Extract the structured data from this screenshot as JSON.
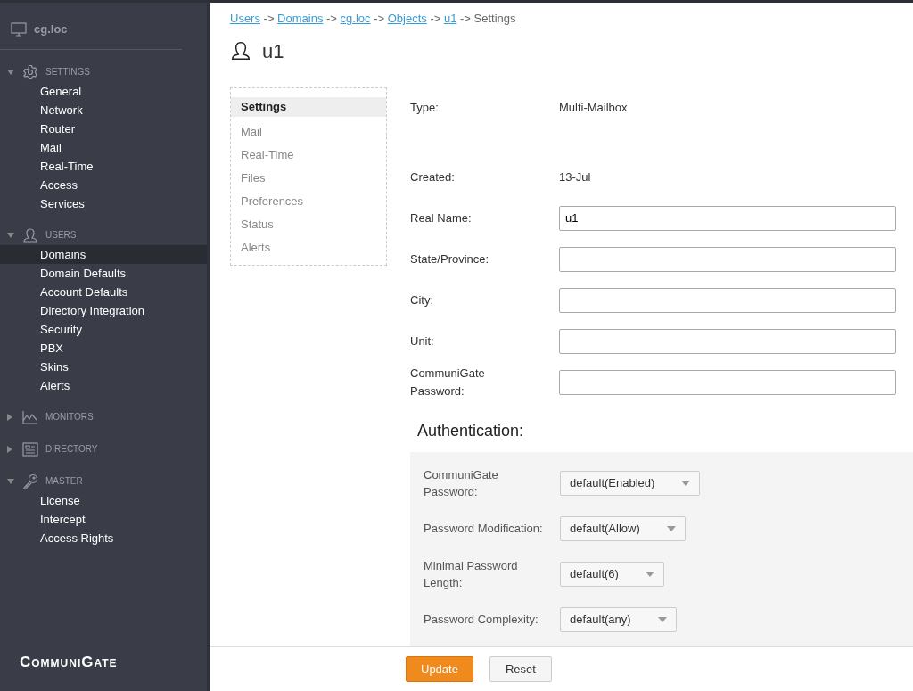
{
  "server": {
    "name": "cg.loc"
  },
  "sidebar": {
    "sections": [
      {
        "title": "SETTINGS",
        "expanded": true,
        "items": [
          {
            "label": "General",
            "selected": false
          },
          {
            "label": "Network",
            "selected": false
          },
          {
            "label": "Router",
            "selected": false
          },
          {
            "label": "Mail",
            "selected": false
          },
          {
            "label": "Real-Time",
            "selected": false
          },
          {
            "label": "Access",
            "selected": false
          },
          {
            "label": "Services",
            "selected": false
          }
        ]
      },
      {
        "title": "USERS",
        "expanded": true,
        "items": [
          {
            "label": "Domains",
            "selected": true
          },
          {
            "label": "Domain Defaults",
            "selected": false
          },
          {
            "label": "Account Defaults",
            "selected": false
          },
          {
            "label": "Directory Integration",
            "selected": false
          },
          {
            "label": "Security",
            "selected": false
          },
          {
            "label": "PBX",
            "selected": false
          },
          {
            "label": "Skins",
            "selected": false
          },
          {
            "label": "Alerts",
            "selected": false
          }
        ]
      },
      {
        "title": "MONITORS",
        "expanded": false
      },
      {
        "title": "DIRECTORY",
        "expanded": false
      },
      {
        "title": "MASTER",
        "expanded": true,
        "items": [
          {
            "label": "License",
            "selected": false
          },
          {
            "label": "Intercept",
            "selected": false
          },
          {
            "label": "Access Rights",
            "selected": false
          }
        ]
      }
    ],
    "logo": "CommuniGate"
  },
  "breadcrumb": {
    "links": [
      "Users",
      "Domains",
      "cg.loc",
      "Objects",
      "u1"
    ],
    "separator": "->",
    "current": "Settings"
  },
  "title": "u1",
  "tabs": [
    {
      "label": "Settings",
      "selected": true
    },
    {
      "label": "Mail",
      "selected": false
    },
    {
      "label": "Real-Time",
      "selected": false
    },
    {
      "label": "Files",
      "selected": false
    },
    {
      "label": "Preferences",
      "selected": false
    },
    {
      "label": "Status",
      "selected": false
    },
    {
      "label": "Alerts",
      "selected": false
    }
  ],
  "fields": [
    {
      "kind": "text",
      "label": "Type:",
      "value": "Multi-Mailbox"
    },
    {
      "kind": "text",
      "label": "Created:",
      "value": "13-Jul"
    },
    {
      "kind": "input",
      "label": "Real Name:",
      "value": "u1"
    },
    {
      "kind": "input",
      "label": "State/Province:"
    },
    {
      "kind": "input",
      "label": "City:"
    },
    {
      "kind": "input",
      "label": "Unit:"
    },
    {
      "kind": "input",
      "label": "CommuniGate Password:"
    }
  ],
  "authentication": {
    "title": "Authentication:",
    "rows": [
      {
        "label": "CommuniGate Password:",
        "value": "default(Enabled)"
      },
      {
        "label": "Password Modification:",
        "value": "default(Allow)"
      },
      {
        "label": "Minimal Password Length:",
        "value": "default(6)"
      },
      {
        "label": "Password Complexity:",
        "value": "default(any)"
      }
    ]
  },
  "buttons": [
    {
      "label": "Update",
      "kind": "primary"
    },
    {
      "label": "Reset",
      "kind": "secondary"
    }
  ]
}
